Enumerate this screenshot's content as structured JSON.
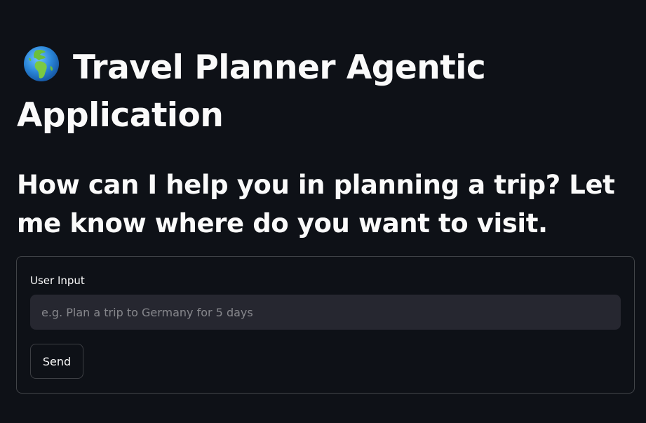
{
  "page": {
    "title_text": "Travel Planner Agentic Application",
    "title_icon": "globe-europe-africa-icon",
    "subtitle": "How can I help you in planning a trip? Let me know where do you want to visit."
  },
  "form": {
    "input_label": "User Input",
    "input_value": "",
    "input_placeholder": "e.g. Plan a trip to Germany for 5 days",
    "send_label": "Send"
  },
  "colors": {
    "background": "#0e1117",
    "text": "#fafafa",
    "input_background": "#262730",
    "border": "#3a3c44"
  }
}
